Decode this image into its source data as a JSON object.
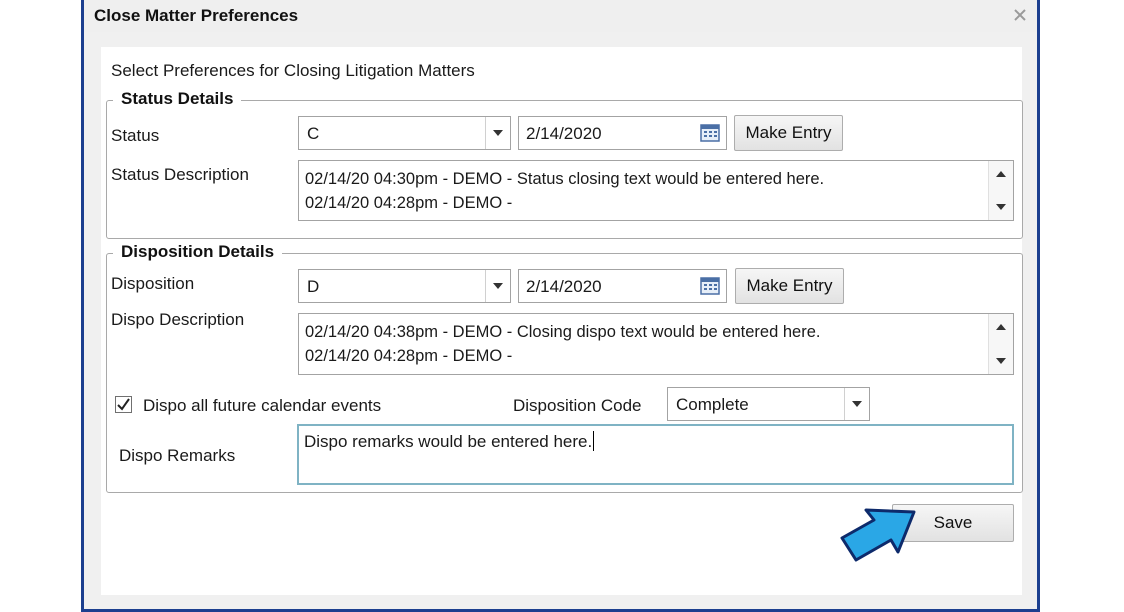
{
  "window": {
    "title": "Close Matter Preferences"
  },
  "intro": "Select Preferences for Closing Litigation Matters",
  "status_details": {
    "legend": "Status Details",
    "status_label": "Status",
    "status_value": "C",
    "date_value": "2/14/2020",
    "make_entry_label": "Make Entry",
    "description_label": "Status Description",
    "description_lines": [
      "02/14/20 04:30pm - DEMO - Status closing text would be entered here.",
      "02/14/20 04:28pm - DEMO -"
    ]
  },
  "disposition_details": {
    "legend": "Disposition Details",
    "disposition_label": "Disposition",
    "disposition_value": "D",
    "date_value": "2/14/2020",
    "make_entry_label": "Make Entry",
    "description_label": "Dispo Description",
    "description_lines": [
      "02/14/20 04:38pm - DEMO - Closing dispo text would be entered here.",
      "02/14/20 04:28pm - DEMO -"
    ],
    "future_events_label": "Dispo all future calendar events",
    "future_events_checked": true,
    "code_label": "Disposition Code",
    "code_value": "Complete",
    "remarks_label": "Dispo Remarks",
    "remarks_value": "Dispo remarks would be entered here."
  },
  "actions": {
    "save_label": "Save"
  },
  "colors": {
    "frame": "#1c3f8f",
    "arrow_fill": "#2aa7e6",
    "arrow_stroke": "#0d2a6b"
  },
  "icons": [
    "close-icon",
    "calendar-icon",
    "chevron-down-icon",
    "scroll-up-icon",
    "scroll-down-icon",
    "checkmark-icon",
    "pointer-arrow-icon"
  ]
}
